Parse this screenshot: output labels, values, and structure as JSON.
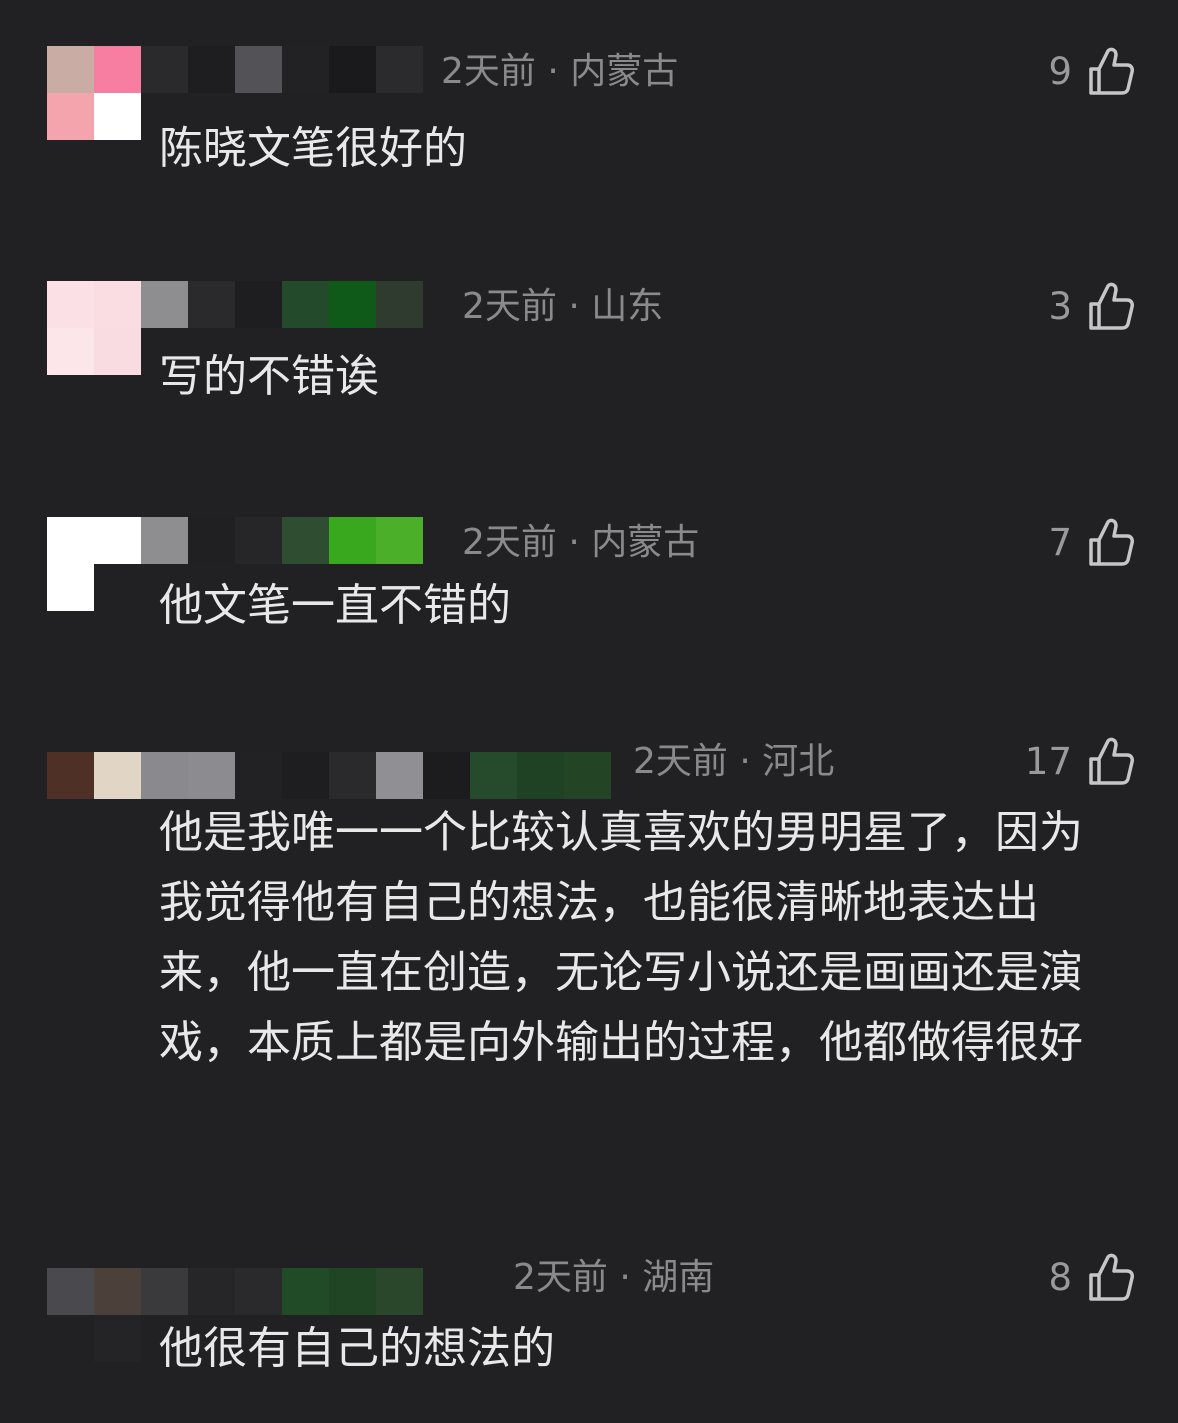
{
  "comments": [
    {
      "time": "2天前",
      "separator": "·",
      "location": "内蒙古",
      "likes": "9",
      "text": "陈晓文笔很好的",
      "avatar_colors": [
        "#c9ada4",
        "#f77ea1",
        "#f4a4ac",
        "#ffffff"
      ],
      "name_colors": [
        "#2a2a2c",
        "#1e1e20",
        "#525257",
        "#222224",
        "#1a1a1c",
        "#2b2b2d"
      ],
      "like_icon": "thumbs-up-icon"
    },
    {
      "time": "2天前",
      "separator": "·",
      "location": "山东",
      "likes": "3",
      "text": "写的不错诶",
      "avatar_colors": [
        "#fbe1e6",
        "#fadde3",
        "#fce6ea",
        "#f9dbe2"
      ],
      "name_colors": [
        "#8e8e90",
        "#2a2a2c",
        "#1e1e20",
        "#234a2a",
        "#0f5a18",
        "#2e3b2e"
      ],
      "like_icon": "thumbs-up-icon"
    },
    {
      "time": "2天前",
      "separator": "·",
      "location": "内蒙古",
      "likes": "7",
      "text": "他文笔一直不错的",
      "avatar_colors": [
        "#ffffff",
        "#ffffff",
        "#ffffff",
        "#212123"
      ],
      "name_colors": [
        "#8e8e90",
        "#202022",
        "#262628",
        "#2f4d30",
        "#3aa81f",
        "#4caf2a"
      ],
      "like_icon": "thumbs-up-icon"
    },
    {
      "time": "2天前",
      "separator": "·",
      "location": "河北",
      "likes": "17",
      "text": "他是我唯一一个比较认真喜欢的男明星了，因为我觉得他有自己的想法，也能很清晰地表达出来，他一直在创造，无论写小说还是画画还是演戏，本质上都是向外输出的过程，他都做得很好",
      "avatar_colors": [
        "#4e3026",
        "#e1d6c6",
        "#2b2b2d",
        "#1e1e20"
      ],
      "name_colors": [
        "#8a8a8e",
        "#8c8c90",
        "#222224",
        "#1e1e20",
        "#2a2a2c",
        "#909094",
        "#1c1c1e",
        "#264a2c",
        "#1f4225",
        "#234526"
      ],
      "like_icon": "thumbs-up-icon"
    },
    {
      "time": "2天前",
      "separator": "·",
      "location": "湖南",
      "likes": "8",
      "text": "他很有自己的想法的",
      "avatar_colors": [
        "#4a4a4e",
        "#4c403a",
        "#212123",
        "#242426"
      ],
      "name_colors": [
        "#3a3a3d",
        "#262628",
        "#2a2a2c",
        "#214a27",
        "#204525",
        "#2a472b"
      ],
      "like_icon": "thumbs-up-icon"
    }
  ]
}
